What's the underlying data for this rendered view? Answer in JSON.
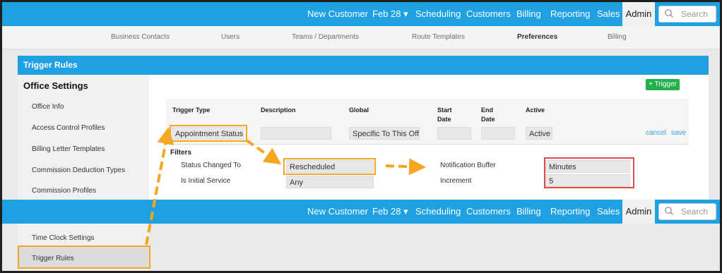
{
  "top_nav": {
    "items": [
      "New Customer",
      "Feb 28",
      "Scheduling",
      "Customers",
      "Billing",
      "Reporting",
      "Sales"
    ],
    "active": "Admin",
    "search_placeholder": "Search"
  },
  "sub_nav": {
    "items": [
      "Business Contacts",
      "Users",
      "Teams / Departments",
      "Route Templates",
      "Preferences",
      "Billing"
    ],
    "active_index": 4
  },
  "panel": {
    "title": "Trigger Rules"
  },
  "sidebar": {
    "heading": "Office Settings",
    "items": [
      "Office Info",
      "Access Control Profiles",
      "Billing Letter Templates",
      "Commission Deduction Types",
      "Commission Profiles"
    ],
    "items_after": [
      "Time Clock Settings",
      "Trigger Rules"
    ],
    "selected": "Trigger Rules"
  },
  "trigger_button": "+ Trigger",
  "table": {
    "headers": {
      "trigger_type": "Trigger Type",
      "description": "Description",
      "global": "Global",
      "start_date": "Start\nDate",
      "end_date": "End\nDate",
      "active": "Active"
    },
    "row": {
      "trigger_type": "Appointment Status",
      "description": "",
      "global": "Specific To This Off",
      "start_date": "",
      "end_date": "",
      "active": "Active"
    },
    "cancel_label": "cancel",
    "save_label": "save"
  },
  "filters": {
    "label": "Filters",
    "status_changed_to_label": "Status Changed To",
    "status_changed_to_value": "Rescheduled",
    "is_initial_service_label": "Is Initial Service",
    "is_initial_service_value": "Any",
    "notification_buffer_label": "Notification Buffer",
    "notification_buffer_value": "Minutes",
    "increment_label": "Increment",
    "increment_value": "5"
  },
  "colors": {
    "nav_blue": "#1ea0e3",
    "highlight_orange": "#f5a623",
    "highlight_red": "#e04a4a",
    "button_green": "#22b14c",
    "link_blue": "#3aa2e0"
  }
}
